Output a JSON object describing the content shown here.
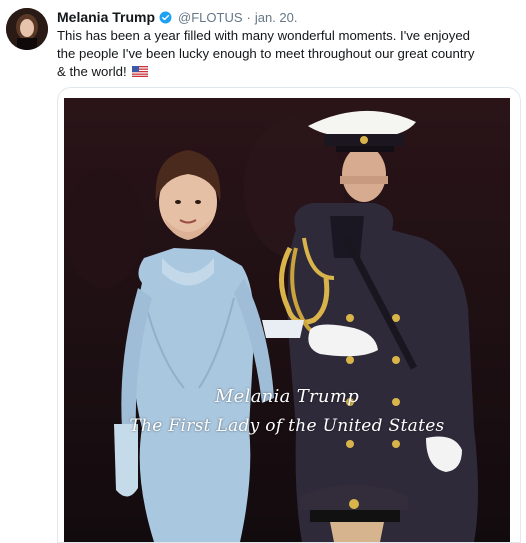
{
  "tweet": {
    "display_name": "Melania Trump",
    "handle": "@FLOTUS",
    "separator": "·",
    "date": "jan. 20.",
    "text": "This has been a year filled with many wonderful moments. I've enjoyed the people I've been lucky enough to meet throughout our great country & the world!",
    "emoji": "us-flag",
    "verified_color": "#1da1f2"
  },
  "media": {
    "caption_line1": "Melania Trump",
    "caption_line2": "The First Lady of the United States"
  }
}
